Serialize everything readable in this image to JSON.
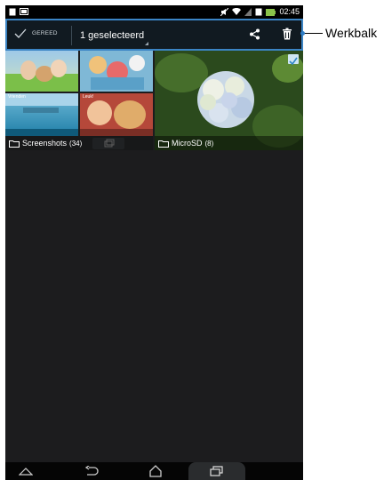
{
  "actionbar": {
    "done_label": "GEREED",
    "selection_label": "1 geselecteerd"
  },
  "albums": [
    {
      "name": "Screenshots",
      "count": "(34)",
      "thumb_labels": [
        "Vrienden",
        "Leuk!"
      ]
    },
    {
      "name": "MicroSD",
      "count": "(8)",
      "selected": true
    }
  ],
  "statusbar": {
    "time": "02:45"
  },
  "callout": {
    "label": "Werkbalk"
  },
  "colors": {
    "accent": "#3b84c4",
    "actionbar": "#111a21",
    "background": "#1c1c1e"
  }
}
